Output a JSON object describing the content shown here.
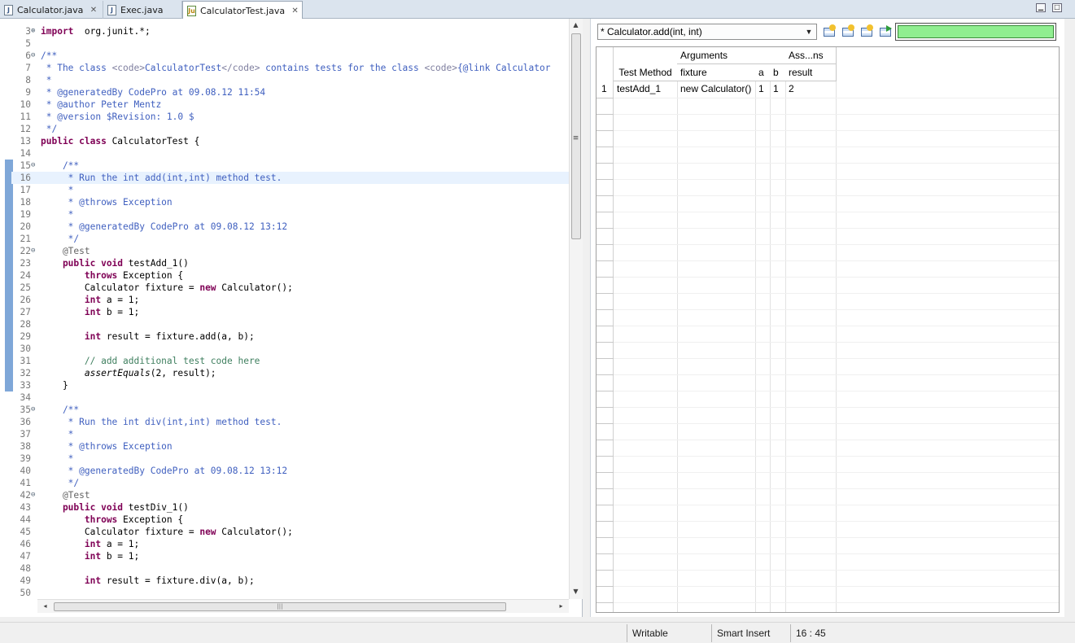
{
  "tabs": [
    {
      "label": "Calculator.java",
      "icon": "java-file-icon",
      "active": false,
      "closable": true
    },
    {
      "label": "Exec.java",
      "icon": "java-file-icon",
      "active": false,
      "closable": false
    },
    {
      "label": "CalculatorTest.java",
      "icon": "junit-file-icon",
      "active": true,
      "closable": true
    }
  ],
  "editor": {
    "lines": [
      {
        "n": "3",
        "fold": "⊕",
        "parts": [
          [
            "kw",
            "import"
          ],
          [
            "",
            "  org.junit.*;"
          ]
        ]
      },
      {
        "n": "5",
        "fold": "",
        "parts": []
      },
      {
        "n": "6",
        "fold": "⊖",
        "parts": [
          [
            "cm",
            "/**"
          ]
        ]
      },
      {
        "n": "7",
        "fold": "",
        "parts": [
          [
            "cm",
            " * The class "
          ],
          [
            "tag",
            "<code>"
          ],
          [
            "cm",
            "CalculatorTest"
          ],
          [
            "tag",
            "</code>"
          ],
          [
            "cm",
            " contains tests for the class "
          ],
          [
            "tag",
            "<code>"
          ],
          [
            "cm",
            "{@link Calculator"
          ]
        ]
      },
      {
        "n": "8",
        "fold": "",
        "parts": [
          [
            "cm",
            " *"
          ]
        ]
      },
      {
        "n": "9",
        "fold": "",
        "parts": [
          [
            "cm",
            " * @generatedBy CodePro at 09.08.12 11:54"
          ]
        ]
      },
      {
        "n": "10",
        "fold": "",
        "parts": [
          [
            "cm",
            " * @author Peter Mentz"
          ]
        ]
      },
      {
        "n": "11",
        "fold": "",
        "parts": [
          [
            "cm",
            " * @version $Revision: 1.0 $"
          ]
        ]
      },
      {
        "n": "12",
        "fold": "",
        "parts": [
          [
            "cm",
            " */"
          ]
        ]
      },
      {
        "n": "13",
        "fold": "",
        "parts": [
          [
            "kw",
            "public class"
          ],
          [
            "",
            " CalculatorTest {"
          ]
        ]
      },
      {
        "n": "14",
        "fold": "",
        "parts": []
      },
      {
        "n": "15",
        "fold": "⊖",
        "parts": [
          [
            "cm",
            "    /**"
          ]
        ]
      },
      {
        "n": "16",
        "fold": "",
        "current": true,
        "parts": [
          [
            "cm",
            "     * Run the int add(int,int) method test."
          ]
        ]
      },
      {
        "n": "17",
        "fold": "",
        "parts": [
          [
            "cm",
            "     *"
          ]
        ]
      },
      {
        "n": "18",
        "fold": "",
        "parts": [
          [
            "cm",
            "     * @throws Exception"
          ]
        ]
      },
      {
        "n": "19",
        "fold": "",
        "parts": [
          [
            "cm",
            "     *"
          ]
        ]
      },
      {
        "n": "20",
        "fold": "",
        "parts": [
          [
            "cm",
            "     * @generatedBy CodePro at 09.08.12 13:12"
          ]
        ]
      },
      {
        "n": "21",
        "fold": "",
        "parts": [
          [
            "cm",
            "     */"
          ]
        ]
      },
      {
        "n": "22",
        "fold": "⊖",
        "parts": [
          [
            "ann",
            "    @Test"
          ]
        ]
      },
      {
        "n": "23",
        "fold": "",
        "parts": [
          [
            "kw",
            "    public void"
          ],
          [
            "",
            " testAdd_1()"
          ]
        ]
      },
      {
        "n": "24",
        "fold": "",
        "parts": [
          [
            "kw",
            "        throws"
          ],
          [
            "",
            " Exception {"
          ]
        ]
      },
      {
        "n": "25",
        "fold": "",
        "parts": [
          [
            "",
            "        Calculator fixture = "
          ],
          [
            "kw",
            "new"
          ],
          [
            "",
            " Calculator();"
          ]
        ]
      },
      {
        "n": "26",
        "fold": "",
        "parts": [
          [
            "kw",
            "        int"
          ],
          [
            "",
            " a = 1;"
          ]
        ]
      },
      {
        "n": "27",
        "fold": "",
        "parts": [
          [
            "kw",
            "        int"
          ],
          [
            "",
            " b = 1;"
          ]
        ]
      },
      {
        "n": "28",
        "fold": "",
        "parts": []
      },
      {
        "n": "29",
        "fold": "",
        "parts": [
          [
            "kw",
            "        int"
          ],
          [
            "",
            " result = fixture.add(a, b);"
          ]
        ]
      },
      {
        "n": "30",
        "fold": "",
        "parts": []
      },
      {
        "n": "31",
        "fold": "",
        "parts": [
          [
            "lc",
            "        // add additional test code here"
          ]
        ]
      },
      {
        "n": "32",
        "fold": "",
        "parts": [
          [
            "it",
            "        assertEquals"
          ],
          [
            "",
            "(2, result);"
          ]
        ]
      },
      {
        "n": "33",
        "fold": "",
        "parts": [
          [
            "",
            "    }"
          ]
        ]
      },
      {
        "n": "34",
        "fold": "",
        "parts": []
      },
      {
        "n": "35",
        "fold": "⊖",
        "parts": [
          [
            "cm",
            "    /**"
          ]
        ]
      },
      {
        "n": "36",
        "fold": "",
        "parts": [
          [
            "cm",
            "     * Run the int div(int,int) method test."
          ]
        ]
      },
      {
        "n": "37",
        "fold": "",
        "parts": [
          [
            "cm",
            "     *"
          ]
        ]
      },
      {
        "n": "38",
        "fold": "",
        "parts": [
          [
            "cm",
            "     * @throws Exception"
          ]
        ]
      },
      {
        "n": "39",
        "fold": "",
        "parts": [
          [
            "cm",
            "     *"
          ]
        ]
      },
      {
        "n": "40",
        "fold": "",
        "parts": [
          [
            "cm",
            "     * @generatedBy CodePro at 09.08.12 13:12"
          ]
        ]
      },
      {
        "n": "41",
        "fold": "",
        "parts": [
          [
            "cm",
            "     */"
          ]
        ]
      },
      {
        "n": "42",
        "fold": "⊖",
        "parts": [
          [
            "ann",
            "    @Test"
          ]
        ]
      },
      {
        "n": "43",
        "fold": "",
        "parts": [
          [
            "kw",
            "    public void"
          ],
          [
            "",
            " testDiv_1()"
          ]
        ]
      },
      {
        "n": "44",
        "fold": "",
        "parts": [
          [
            "kw",
            "        throws"
          ],
          [
            "",
            " Exception {"
          ]
        ]
      },
      {
        "n": "45",
        "fold": "",
        "parts": [
          [
            "",
            "        Calculator fixture = "
          ],
          [
            "kw",
            "new"
          ],
          [
            "",
            " Calculator();"
          ]
        ]
      },
      {
        "n": "46",
        "fold": "",
        "parts": [
          [
            "kw",
            "        int"
          ],
          [
            "",
            " a = 1;"
          ]
        ]
      },
      {
        "n": "47",
        "fold": "",
        "parts": [
          [
            "kw",
            "        int"
          ],
          [
            "",
            " b = 1;"
          ]
        ]
      },
      {
        "n": "48",
        "fold": "",
        "parts": []
      },
      {
        "n": "49",
        "fold": "",
        "parts": [
          [
            "kw",
            "        int"
          ],
          [
            "",
            " result = fixture.div(a, b);"
          ]
        ]
      },
      {
        "n": "50",
        "fold": "",
        "parts": []
      }
    ]
  },
  "panel": {
    "method_combo": "* Calculator.add(int, int)",
    "toolbar_icons": [
      "add-test-row-icon",
      "add-column-icon",
      "generate-tests-icon",
      "run-tests-icon"
    ],
    "progress_status_color": "#90ee90",
    "table": {
      "group_headers": {
        "arguments": "Arguments",
        "assertions": "Ass...ns"
      },
      "columns": {
        "test_method": "Test Method",
        "fixture": "fixture",
        "a": "a",
        "b": "b",
        "result": "result"
      },
      "rows": [
        {
          "num": "1",
          "test_method": "testAdd_1",
          "fixture": "new Calculator()",
          "a": "1",
          "b": "1",
          "result": "2"
        }
      ]
    }
  },
  "statusbar": {
    "mode": "Writable",
    "insert": "Smart Insert",
    "position": "16 : 45"
  }
}
